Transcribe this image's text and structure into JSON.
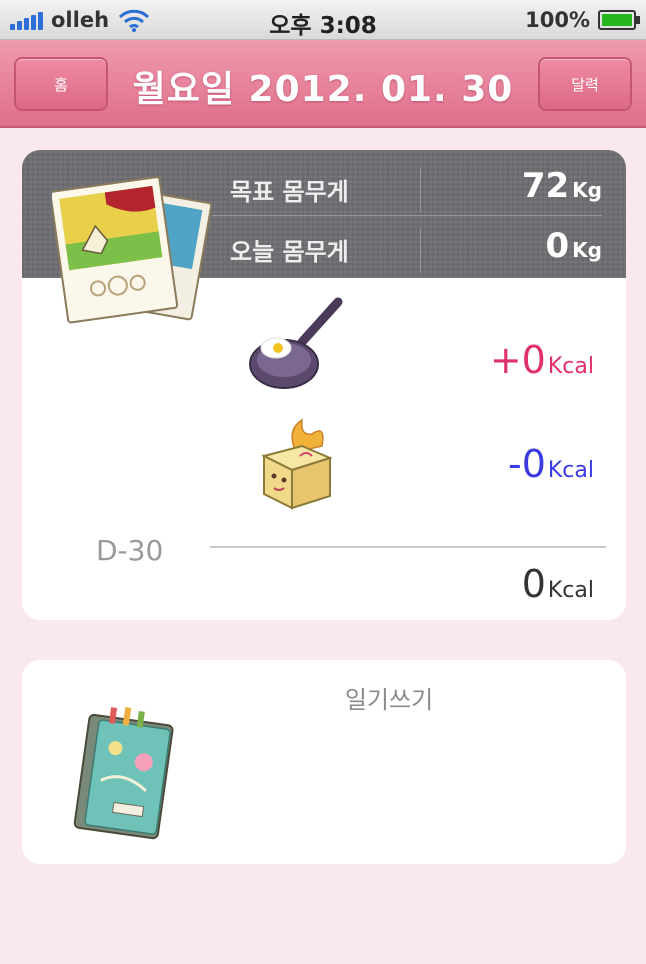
{
  "status_bar": {
    "carrier": "olleh",
    "time_prefix": "오후",
    "time": "3:08",
    "battery_percent": "100%",
    "battery_level": 1.0
  },
  "nav": {
    "left_button": "홈",
    "title": "월요일 2012. 01. 30",
    "right_button": "달력"
  },
  "weight": {
    "target_label": "목표 몸무게",
    "target_value": "72",
    "target_unit": "Kg",
    "today_label": "오늘 몸무게",
    "today_value": "0",
    "today_unit": "Kg"
  },
  "calories": {
    "intake_value": "+0",
    "intake_unit": "Kcal",
    "burn_value": "-0",
    "burn_unit": "Kcal",
    "dday": "D-30",
    "total_value": "0",
    "total_unit": "Kcal"
  },
  "diary": {
    "label": "일기쓰기"
  },
  "colors": {
    "background": "#f9e8ed",
    "nav": "#e17e97",
    "intake": "#e0306a",
    "burn": "#3a3ae0"
  },
  "icons": [
    "signal-icon",
    "wifi-icon",
    "battery-icon",
    "photo-stack-icon",
    "frying-pan-icon",
    "burning-box-icon",
    "notebook-icon"
  ]
}
